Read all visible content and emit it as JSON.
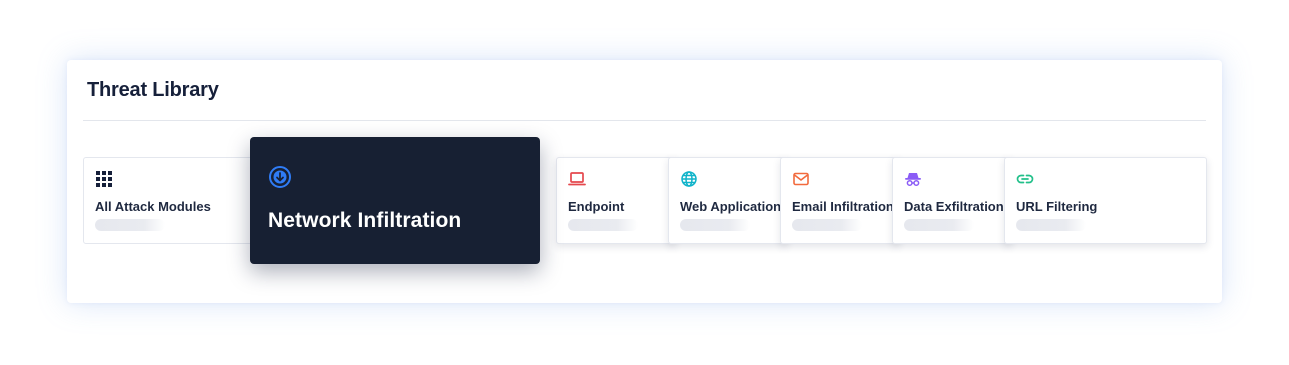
{
  "title": "Threat Library",
  "featured": {
    "label": "Network Infiltration",
    "icon": "download-circle-icon",
    "accent": "#2f7cf6"
  },
  "modules": [
    {
      "label": "All Attack Modules",
      "icon": "grid-icon",
      "color": "#16203a"
    },
    {
      "label": "Endpoint",
      "icon": "laptop-icon",
      "color": "#e5484d"
    },
    {
      "label": "Web Application",
      "icon": "globe-icon",
      "color": "#0fb3c9"
    },
    {
      "label": "Email Infiltration",
      "icon": "envelope-icon",
      "color": "#f26a3d"
    },
    {
      "label": "Data Exfiltration",
      "icon": "spy-icon",
      "color": "#8b5cf6"
    },
    {
      "label": "URL Filtering",
      "icon": "link-icon",
      "color": "#22c08a"
    }
  ]
}
